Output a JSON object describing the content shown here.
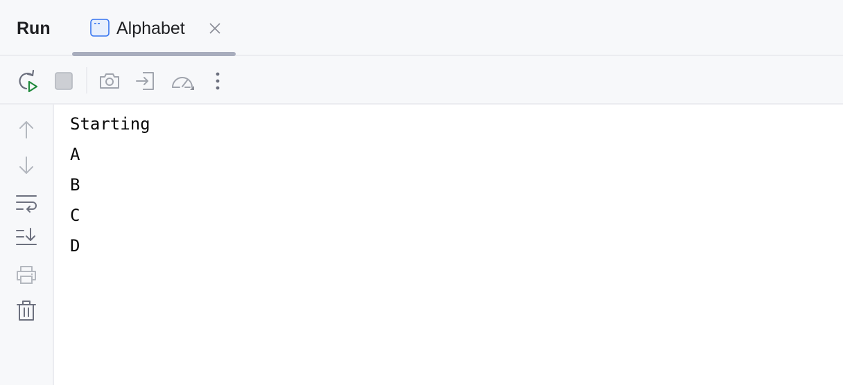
{
  "tool_window": {
    "title": "Run"
  },
  "tab": {
    "label": "Alphabet",
    "icon": "console-window-icon"
  },
  "toolbar": {
    "buttons": [
      {
        "name": "rerun",
        "icon": "rerun-icon"
      },
      {
        "name": "stop",
        "icon": "stop-icon"
      },
      {
        "name": "screenshot",
        "icon": "camera-icon"
      },
      {
        "name": "restore-layout",
        "icon": "enter-icon"
      },
      {
        "name": "profiler",
        "icon": "speedometer-icon"
      },
      {
        "name": "more",
        "icon": "more-vertical-icon"
      }
    ]
  },
  "sidebar": {
    "buttons": [
      {
        "name": "up-stack-trace",
        "icon": "arrow-up-icon"
      },
      {
        "name": "down-stack-trace",
        "icon": "arrow-down-icon"
      },
      {
        "name": "soft-wrap",
        "icon": "soft-wrap-icon"
      },
      {
        "name": "scroll-to-end",
        "icon": "scroll-to-end-icon"
      },
      {
        "name": "print",
        "icon": "printer-icon"
      },
      {
        "name": "clear-all",
        "icon": "trash-icon"
      }
    ]
  },
  "console": {
    "lines": [
      "Starting",
      "A",
      "B",
      "C",
      "D"
    ]
  },
  "colors": {
    "run_green": "#208a3c",
    "icon_gray": "#6c707e",
    "icon_disabled": "#b4b8bf",
    "tab_icon_blue": "#3574f0",
    "underline": "#a8adbd"
  }
}
